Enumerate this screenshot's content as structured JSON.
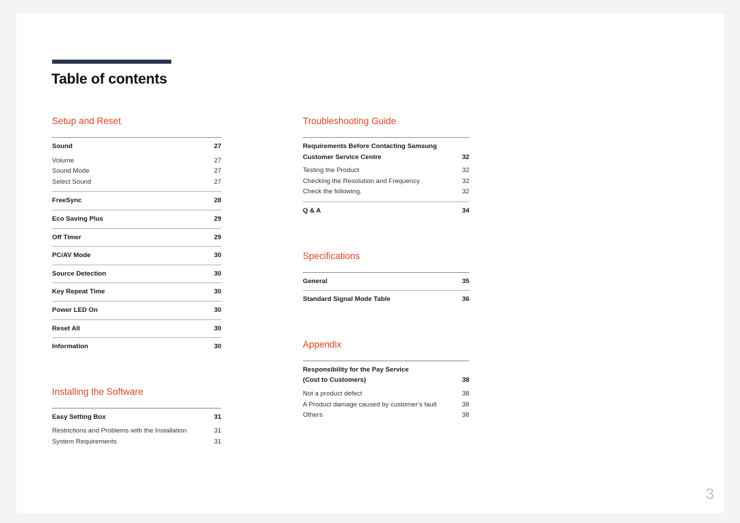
{
  "document": {
    "title": "Table of contents",
    "folio": "3",
    "accent_color": "#d9461f",
    "title_bar_color": "#2c3450"
  },
  "columns": {
    "left": [
      {
        "title": "Setup and Reset",
        "groups": [
          {
            "entries": [
              {
                "label": "Sound",
                "page": "27",
                "level": "major"
              },
              {
                "label": "Volume",
                "page": "27",
                "level": "minor"
              },
              {
                "label": "Sound Mode",
                "page": "27",
                "level": "minor"
              },
              {
                "label": "Select Sound",
                "page": "27",
                "level": "minor"
              }
            ]
          },
          {
            "entries": [
              {
                "label": "FreeSync",
                "page": "28",
                "level": "major"
              }
            ]
          },
          {
            "entries": [
              {
                "label": "Eco Saving Plus",
                "page": "29",
                "level": "major"
              }
            ]
          },
          {
            "entries": [
              {
                "label": "Off Timer",
                "page": "29",
                "level": "major"
              }
            ]
          },
          {
            "entries": [
              {
                "label": "PC/AV Mode",
                "page": "30",
                "level": "major"
              }
            ]
          },
          {
            "entries": [
              {
                "label": "Source Detection",
                "page": "30",
                "level": "major"
              }
            ]
          },
          {
            "entries": [
              {
                "label": "Key Repeat Time",
                "page": "30",
                "level": "major"
              }
            ]
          },
          {
            "entries": [
              {
                "label": "Power LED On",
                "page": "30",
                "level": "major"
              }
            ]
          },
          {
            "entries": [
              {
                "label": "Reset All",
                "page": "30",
                "level": "major"
              }
            ]
          },
          {
            "entries": [
              {
                "label": "Information",
                "page": "30",
                "level": "major"
              }
            ]
          }
        ]
      },
      {
        "title": "Installing the Software",
        "groups": [
          {
            "entries": [
              {
                "label": "Easy Setting Box",
                "page": "31",
                "level": "major"
              },
              {
                "label": "Restrictions and Problems with the Installation",
                "page": "31",
                "level": "minor"
              },
              {
                "label": "System Requirements",
                "page": "31",
                "level": "minor"
              }
            ]
          }
        ]
      }
    ],
    "right": [
      {
        "title": "Troubleshooting Guide",
        "groups": [
          {
            "entries": [
              {
                "label": "Requirements Before Contacting Samsung",
                "label2": "Customer Service Centre",
                "page": "32",
                "level": "major-wrap"
              },
              {
                "label": "Testing the Product",
                "page": "32",
                "level": "minor"
              },
              {
                "label": "Checking the Resolution and Frequency",
                "page": "32",
                "level": "minor"
              },
              {
                "label": "Check the following.",
                "page": "32",
                "level": "minor"
              }
            ]
          },
          {
            "entries": [
              {
                "label": "Q & A",
                "page": "34",
                "level": "major"
              }
            ]
          }
        ]
      },
      {
        "title": "Specifications",
        "groups": [
          {
            "entries": [
              {
                "label": "General",
                "page": "35",
                "level": "major"
              }
            ]
          },
          {
            "entries": [
              {
                "label": "Standard Signal Mode Table",
                "page": "36",
                "level": "major"
              }
            ]
          }
        ]
      },
      {
        "title": "Appendix",
        "groups": [
          {
            "entries": [
              {
                "label": "Responsibility for the Pay Service",
                "label2": "(Cost to Customers)",
                "page": "38",
                "level": "major-wrap"
              },
              {
                "label": "Not a product defect",
                "page": "38",
                "level": "minor"
              },
              {
                "label": "A Product damage caused by customer’s fault",
                "page": "38",
                "level": "minor"
              },
              {
                "label": "Others",
                "page": "38",
                "level": "minor"
              }
            ]
          }
        ]
      }
    ]
  }
}
